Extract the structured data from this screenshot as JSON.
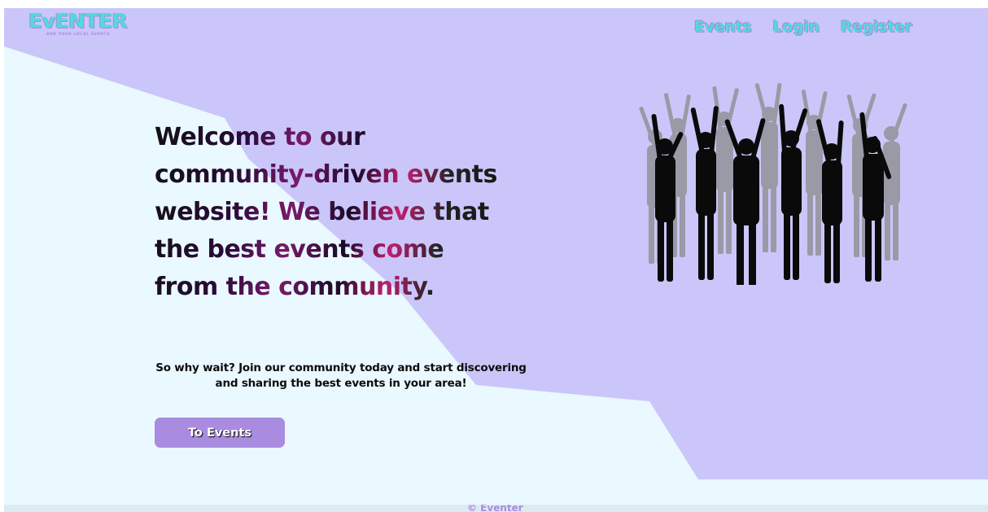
{
  "brand": {
    "logo": "EvENTER",
    "tagline": "ADD YOUR LOCAL EVENTS"
  },
  "nav": {
    "items": [
      {
        "label": "Events"
      },
      {
        "label": "Login"
      },
      {
        "label": "Register"
      }
    ]
  },
  "hero": {
    "headline": "Welcome to our community-driven events website! We believe that the best events come from the community.",
    "subtext": "So why wait? Join our community today and start discovering and sharing the best events in your area!",
    "cta_label": "To Events",
    "image": "crowd-silhouette-icon"
  },
  "footer": {
    "text": "© Eventer"
  },
  "colors": {
    "page_bg": "#eaf8ff",
    "shape_bg": "#cac6fa",
    "accent": "#a98bdf",
    "logo_text": "#53d9de",
    "footer_bg": "#dcebf2"
  }
}
